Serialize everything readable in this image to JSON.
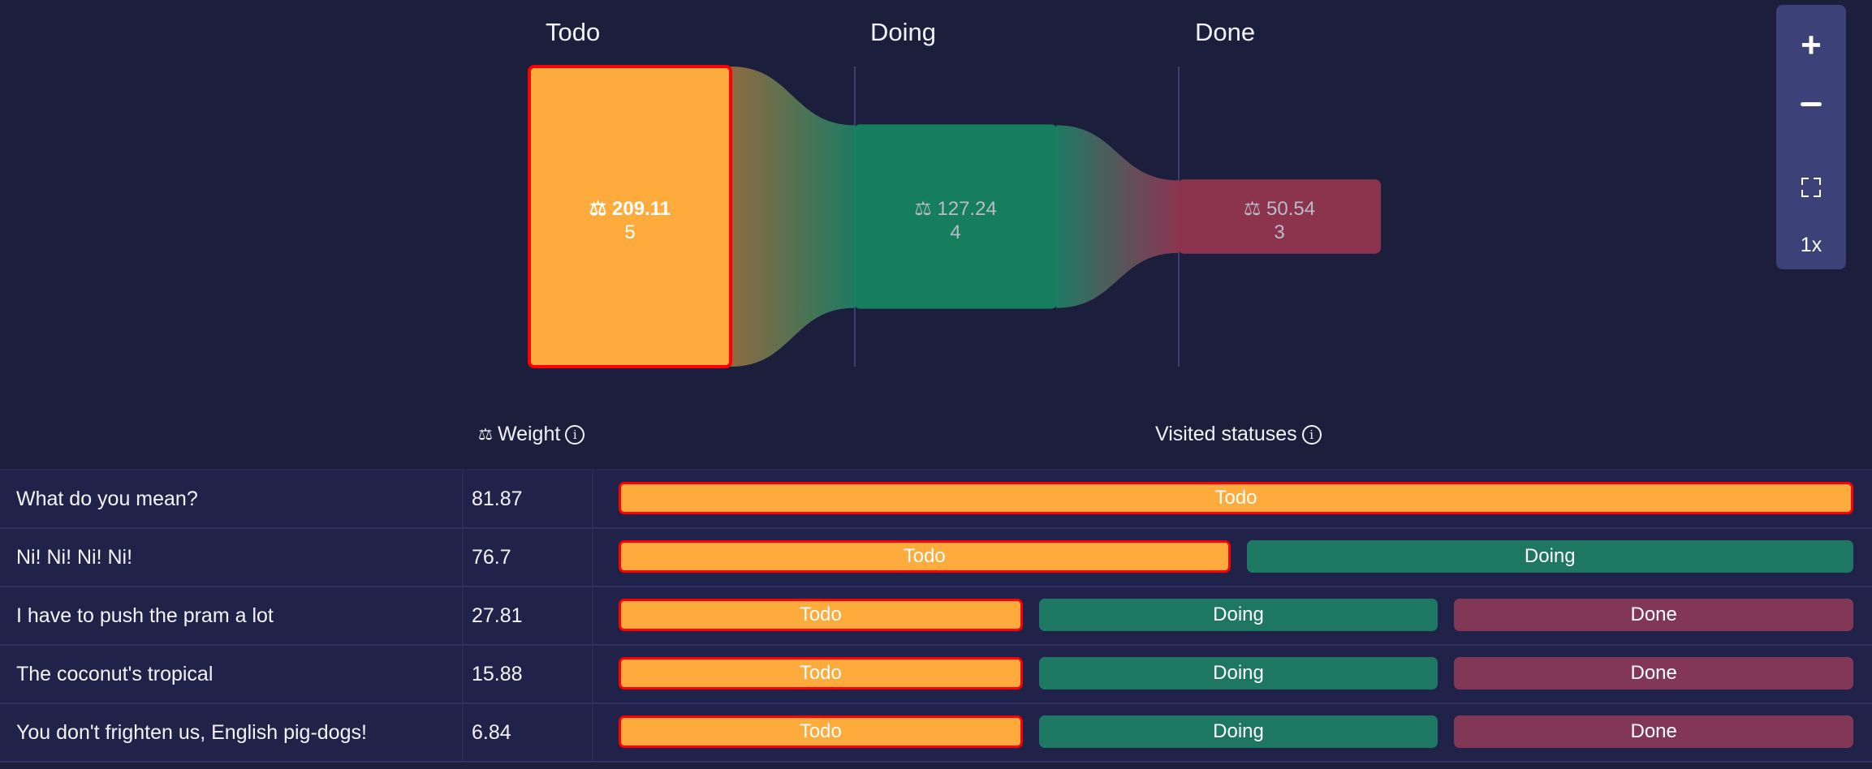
{
  "chart_data": {
    "type": "sankey",
    "title": "",
    "stages": [
      {
        "name": "Todo",
        "weight": 209.11,
        "weight_label": "209.11",
        "count": 5,
        "color": "#fdab3d",
        "selected": true
      },
      {
        "name": "Doing",
        "weight": 127.24,
        "weight_label": "127.24",
        "count": 4,
        "color": "#17845f",
        "selected": false
      },
      {
        "name": "Done",
        "weight": 50.54,
        "weight_label": "50.54",
        "count": 3,
        "color": "#93354f",
        "selected": false
      }
    ],
    "flows": [
      {
        "from": "Todo",
        "to": "Doing",
        "weight": 127.24
      },
      {
        "from": "Doing",
        "to": "Done",
        "weight": 50.54
      }
    ],
    "weight_icon": "⚖"
  },
  "zoom_controls": {
    "zoom_in_label": "+",
    "zoom_out_label": "−",
    "fit_icon": "fullscreen-icon",
    "zoom_level": "1x"
  },
  "table": {
    "headers": {
      "weight": "Weight",
      "weight_icon": "⚖",
      "visited": "Visited statuses",
      "info_icon": "i"
    },
    "rows": [
      {
        "title": "What do you mean?",
        "weight": "81.87",
        "statuses": [
          "Todo"
        ]
      },
      {
        "title": "Ni! Ni! Ni! Ni!",
        "weight": "76.7",
        "statuses": [
          "Todo",
          "Doing"
        ]
      },
      {
        "title": "I have to push the pram a lot",
        "weight": "27.81",
        "statuses": [
          "Todo",
          "Doing",
          "Done"
        ]
      },
      {
        "title": "The coconut's tropical",
        "weight": "15.88",
        "statuses": [
          "Todo",
          "Doing",
          "Done"
        ]
      },
      {
        "title": "You don't frighten us, English pig-dogs!",
        "weight": "6.84",
        "statuses": [
          "Todo",
          "Doing",
          "Done"
        ]
      }
    ]
  },
  "colors": {
    "background": "#1c1f3b",
    "todo": "#fdab3d",
    "doing": "#1d7762",
    "done": "#823757",
    "selected_border": "#ff0000"
  }
}
